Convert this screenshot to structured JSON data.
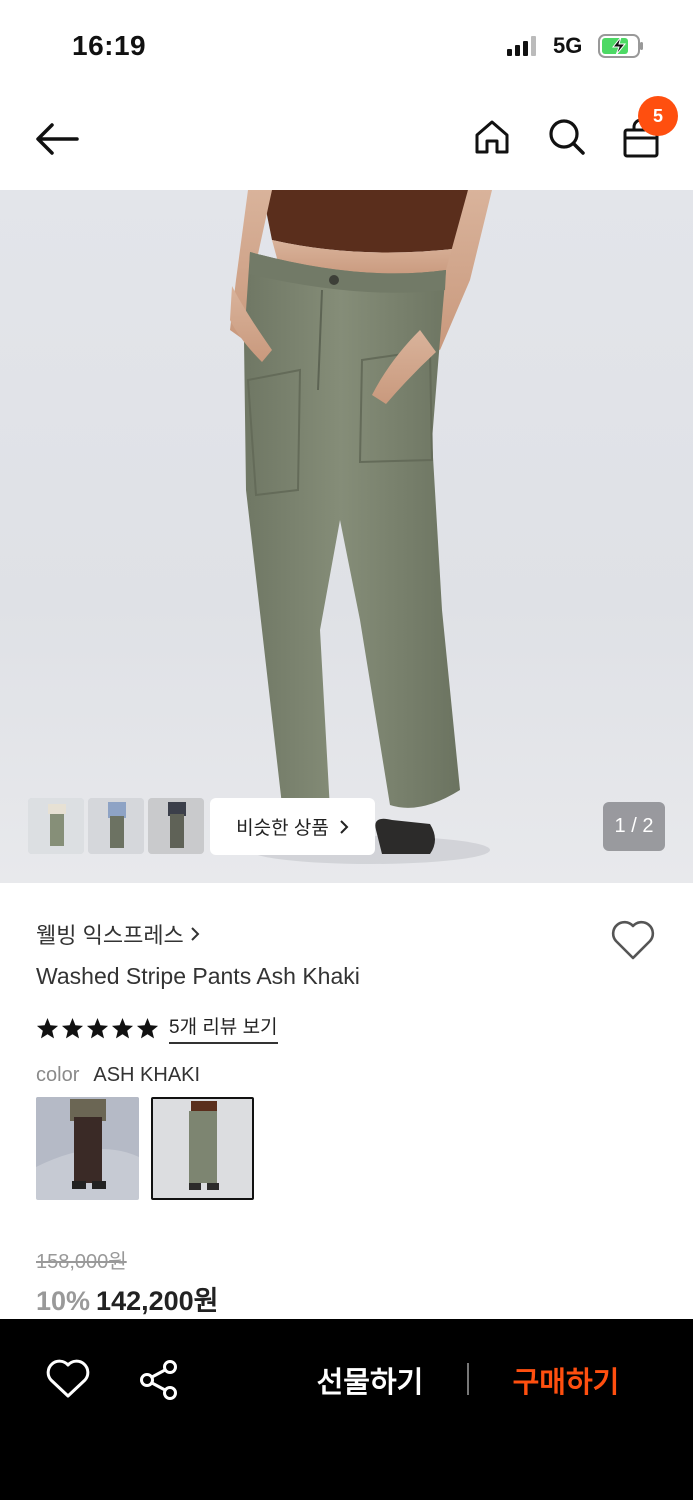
{
  "status_bar": {
    "time": "16:19",
    "network": "5G"
  },
  "nav": {
    "cart_count": "5"
  },
  "hero": {
    "similar_label": "비슷한 상품",
    "page_indicator": "1 / 2"
  },
  "product": {
    "brand": "웰빙 익스프레스",
    "name": "Washed Stripe Pants Ash Khaki",
    "rating_stars": 5,
    "review_link": "5개 리뷰 보기",
    "color_label": "color",
    "color_value": "ASH KHAKI",
    "original_price": "158,000원",
    "discount": "10%",
    "sale_price": "142,200원"
  },
  "bottom_bar": {
    "gift_label": "선물하기",
    "buy_label": "구매하기"
  },
  "colors": {
    "accent": "#ff4f0f",
    "bottom_bar_bg": "#000000",
    "pants_khaki": "#7c8470"
  }
}
